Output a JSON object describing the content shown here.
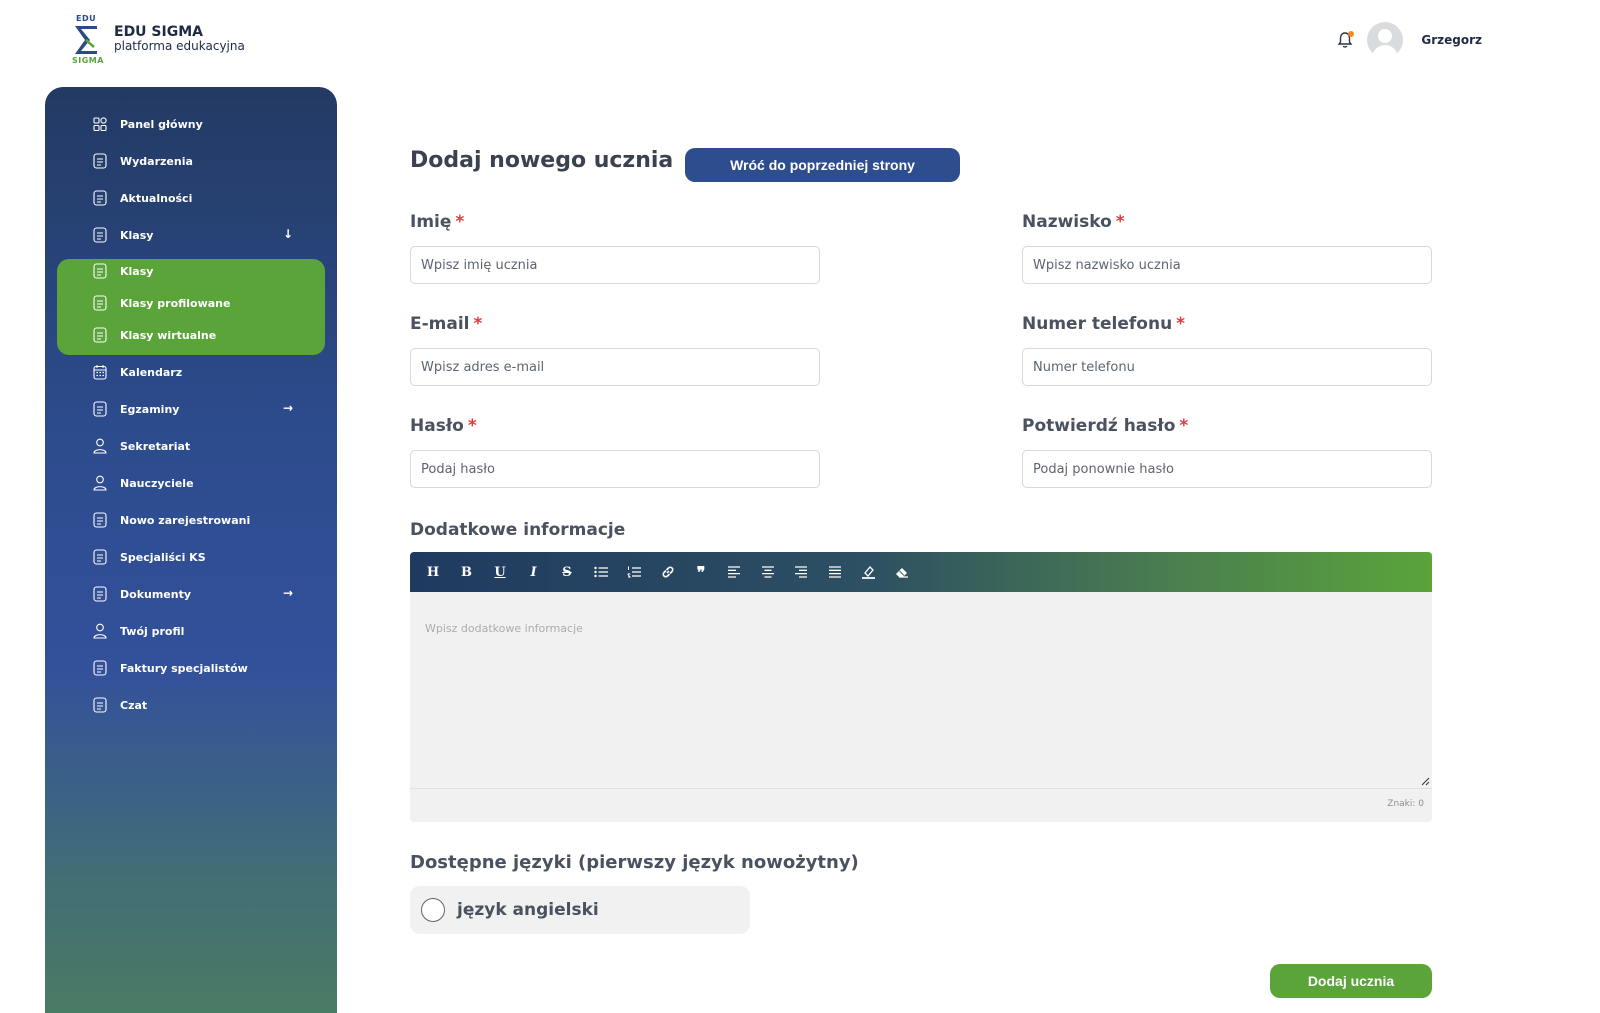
{
  "brand": {
    "mark_top": "EDU",
    "mark_bottom": "SIGMA",
    "name": "EDU SIGMA",
    "tagline": "platforma edukacyjna"
  },
  "header": {
    "user_name": "Grzegorz",
    "notification_icon": "bell-icon"
  },
  "colors": {
    "sidebar_top": "#233a63",
    "sidebar_bottom": "#4a7d62",
    "accent_green": "#5aa43a",
    "primary_blue": "#2e4d8f",
    "required": "#e23a3a"
  },
  "sidebar": {
    "items": [
      {
        "label": "Panel główny",
        "icon": "dashboard-icon"
      },
      {
        "label": "Wydarzenia",
        "icon": "document-icon"
      },
      {
        "label": "Aktualności",
        "icon": "document-icon"
      },
      {
        "label": "Klasy",
        "icon": "document-icon",
        "arrow": "↓"
      },
      {
        "label": "Klasy",
        "icon": "document-icon"
      },
      {
        "label": "Klasy profilowane",
        "icon": "document-icon"
      },
      {
        "label": "Klasy wirtualne",
        "icon": "document-icon"
      },
      {
        "label": "Kalendarz",
        "icon": "calendar-icon"
      },
      {
        "label": "Egzaminy",
        "icon": "document-icon",
        "arrow": "→"
      },
      {
        "label": "Sekretariat",
        "icon": "person-icon"
      },
      {
        "label": "Nauczyciele",
        "icon": "person-icon"
      },
      {
        "label": "Nowo zarejestrowani",
        "icon": "document-icon"
      },
      {
        "label": "Specjaliści KS",
        "icon": "document-icon"
      },
      {
        "label": "Dokumenty",
        "icon": "document-icon",
        "arrow": "→"
      },
      {
        "label": "Twój profil",
        "icon": "person-icon"
      },
      {
        "label": "Faktury specjalistów",
        "icon": "document-icon"
      },
      {
        "label": "Czat",
        "icon": "document-icon"
      }
    ]
  },
  "main": {
    "title": "Dodaj nowego ucznia",
    "back_button": "Wróć do poprzedniej strony",
    "required_mark": "*",
    "fields": {
      "first_name": {
        "label": "Imię",
        "placeholder": "Wpisz imię ucznia",
        "value": ""
      },
      "last_name": {
        "label": "Nazwisko",
        "placeholder": "Wpisz nazwisko ucznia",
        "value": ""
      },
      "email": {
        "label": "E-mail",
        "placeholder": "Wpisz adres e-mail",
        "value": ""
      },
      "phone": {
        "label": "Numer telefonu",
        "placeholder": "Numer telefonu",
        "value": ""
      },
      "password": {
        "label": "Hasło",
        "placeholder": "Podaj hasło",
        "value": ""
      },
      "password_confirm": {
        "label": "Potwierdź hasło",
        "placeholder": "Podaj ponownie hasło",
        "value": ""
      }
    },
    "additional_info": {
      "label": "Dodatkowe informacje",
      "placeholder": "Wpisz dodatkowe informacje",
      "char_count": "Znaki: 0",
      "toolbar": [
        {
          "name": "heading",
          "glyph": "H"
        },
        {
          "name": "bold",
          "glyph": "B"
        },
        {
          "name": "underline",
          "glyph": "U"
        },
        {
          "name": "italic",
          "glyph": "I"
        },
        {
          "name": "strikethrough",
          "glyph": "S"
        },
        {
          "name": "bullet-list",
          "glyph": ""
        },
        {
          "name": "numbered-list",
          "glyph": ""
        },
        {
          "name": "link",
          "glyph": ""
        },
        {
          "name": "quote",
          "glyph": "❞"
        },
        {
          "name": "align-left",
          "glyph": ""
        },
        {
          "name": "align-center",
          "glyph": ""
        },
        {
          "name": "align-right",
          "glyph": ""
        },
        {
          "name": "align-justify",
          "glyph": ""
        },
        {
          "name": "highlight",
          "glyph": ""
        },
        {
          "name": "clear-format",
          "glyph": ""
        }
      ]
    },
    "languages": {
      "title": "Dostępne języki (pierwszy język nowożytny)",
      "options": [
        {
          "label": "język angielski",
          "selected": false
        }
      ]
    },
    "submit_button": "Dodaj ucznia"
  }
}
